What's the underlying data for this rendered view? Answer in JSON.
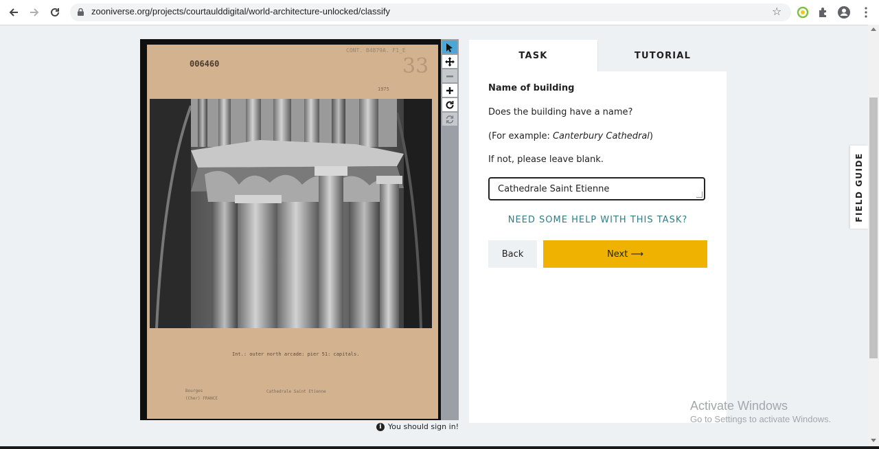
{
  "browser": {
    "url": "zooniverse.org/projects/courtaulddigital/world-architecture-unlocked/classify"
  },
  "scan": {
    "catalog_number": "006460",
    "pencil_number": "33",
    "ref_code": "CONT. B4879A. F1_E",
    "year": "1975",
    "caption": "Int.: outer north arcade: pier 51: capitals.",
    "location_line1": "Bourges",
    "location_line2": "(Cher)  FRANCE",
    "building_label": "Cathedrale Saint Etienne"
  },
  "viewer": {
    "sign_in_note": "You should sign in!"
  },
  "task_panel": {
    "tabs": [
      {
        "label": "TASK"
      },
      {
        "label": "TUTORIAL"
      }
    ],
    "title": "Name of building",
    "question": "Does the building have a name?",
    "example_prefix": "(For example: ",
    "example_name": "Canterbury Cathedral",
    "example_suffix": ")",
    "instruction": "If not, please leave blank.",
    "answer_value": "Cathedrale Saint Etienne",
    "help_link": "NEED SOME HELP WITH THIS TASK?",
    "back_label": "Back",
    "next_label": "Next",
    "next_arrow": "⟶"
  },
  "field_guide": {
    "label": "FIELD GUIDE"
  },
  "watermark": {
    "title": "Activate Windows",
    "subtitle": "Go to Settings to activate Windows."
  },
  "colors": {
    "next_button": "#f0b200",
    "help_link": "#2c7d85",
    "active_tool": "#4aa7d8"
  },
  "icons": {
    "back": "arrow-left-icon",
    "forward": "arrow-right-icon",
    "reload": "reload-icon",
    "lock": "lock-icon",
    "bookmark": "star-icon",
    "extension_green": "extension-icon",
    "extensions": "puzzle-icon",
    "profile": "account-icon",
    "menu": "kebab-menu-icon",
    "tools": [
      "pointer-icon",
      "pan-icon",
      "zoom-out-icon",
      "zoom-in-icon",
      "rotate-icon",
      "reset-icon"
    ],
    "info": "info-icon"
  }
}
